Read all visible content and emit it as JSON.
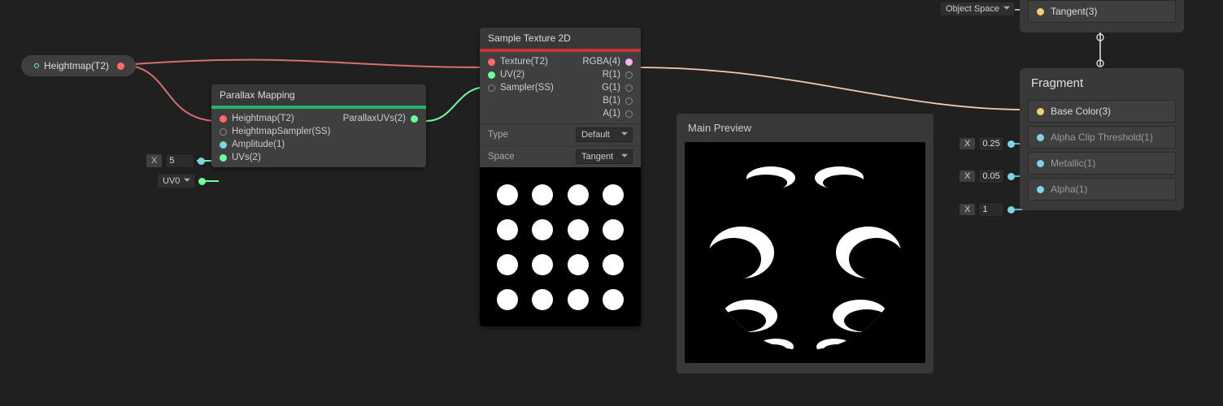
{
  "heightmap_pill": {
    "label": "Heightmap(T2)"
  },
  "parallax_node": {
    "title": "Parallax Mapping",
    "inputs": {
      "heightmap": "Heightmap(T2)",
      "sampler": "HeightmapSampler(SS)",
      "amplitude": "Amplitude(1)",
      "uvs": "UVs(2)"
    },
    "outputs": {
      "parallax_uvs": "ParallaxUVs(2)"
    }
  },
  "amplitude_float": {
    "label": "X",
    "value": "5"
  },
  "uv_dropdown": {
    "value": "UV0"
  },
  "sample_node": {
    "title": "Sample Texture 2D",
    "inputs": {
      "texture": "Texture(T2)",
      "uv": "UV(2)",
      "sampler": "Sampler(SS)"
    },
    "outputs": {
      "rgba": "RGBA(4)",
      "r": "R(1)",
      "g": "G(1)",
      "b": "B(1)",
      "a": "A(1)"
    },
    "props": {
      "type_label": "Type",
      "type_value": "Default",
      "space_label": "Space",
      "space_value": "Tangent"
    }
  },
  "main_preview": {
    "title": "Main Preview"
  },
  "top_block": {
    "dropdown_value": "Object Space",
    "port_label": "Tangent(3)"
  },
  "fragment": {
    "title": "Fragment",
    "rows": {
      "base_color": "Base Color(3)",
      "alpha_clip": "Alpha Clip Threshold(1)",
      "metallic": "Metallic(1)",
      "alpha": "Alpha(1)"
    }
  },
  "frag_floats": {
    "alpha_clip": {
      "label": "X",
      "value": "0.25"
    },
    "metallic": {
      "label": "X",
      "value": "0.05"
    },
    "alpha": {
      "label": "X",
      "value": "1"
    }
  }
}
